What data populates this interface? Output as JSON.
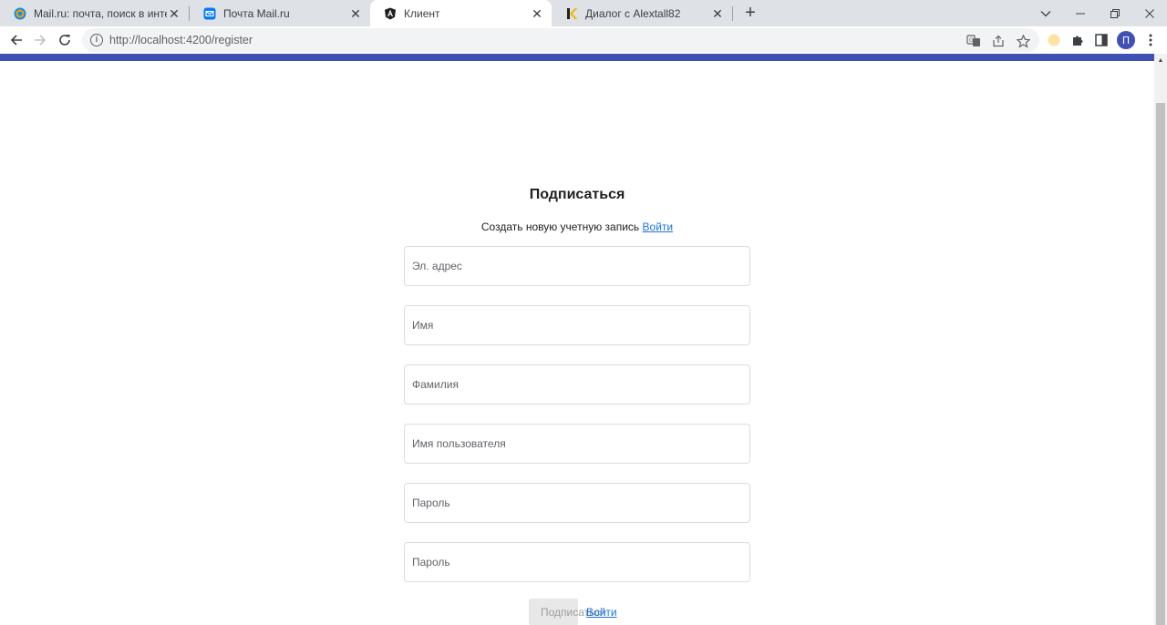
{
  "browser": {
    "tabs": [
      {
        "title": "Mail.ru: почта, поиск в интернете",
        "favicon": "mailru-at-icon",
        "active": false
      },
      {
        "title": "Почта Mail.ru",
        "favicon": "mail-envelope-icon",
        "active": false
      },
      {
        "title": "Клиент",
        "favicon": "angular-icon",
        "active": true
      },
      {
        "title": "Диалог с Alextall82",
        "favicon": "kwork-k-icon",
        "active": false
      }
    ],
    "url": "http://localhost:4200/register",
    "profile_initial": "П"
  },
  "colors": {
    "accent_bar": "#3f51b5",
    "link": "#1a73e8",
    "profile_avatar": "#3f51b5"
  },
  "register": {
    "title": "Подписаться",
    "subtitle": "Создать новую учетную запись",
    "login_link": "Войти",
    "fields": {
      "email_placeholder": "Эл. адрес",
      "first_name_placeholder": "Имя",
      "last_name_placeholder": "Фамилия",
      "username_placeholder": "Имя пользователя",
      "password_placeholder": "Пароль",
      "password_confirm_placeholder": "Пароль"
    },
    "submit_label": "Подписаться",
    "bottom_login_link": "Войти"
  }
}
